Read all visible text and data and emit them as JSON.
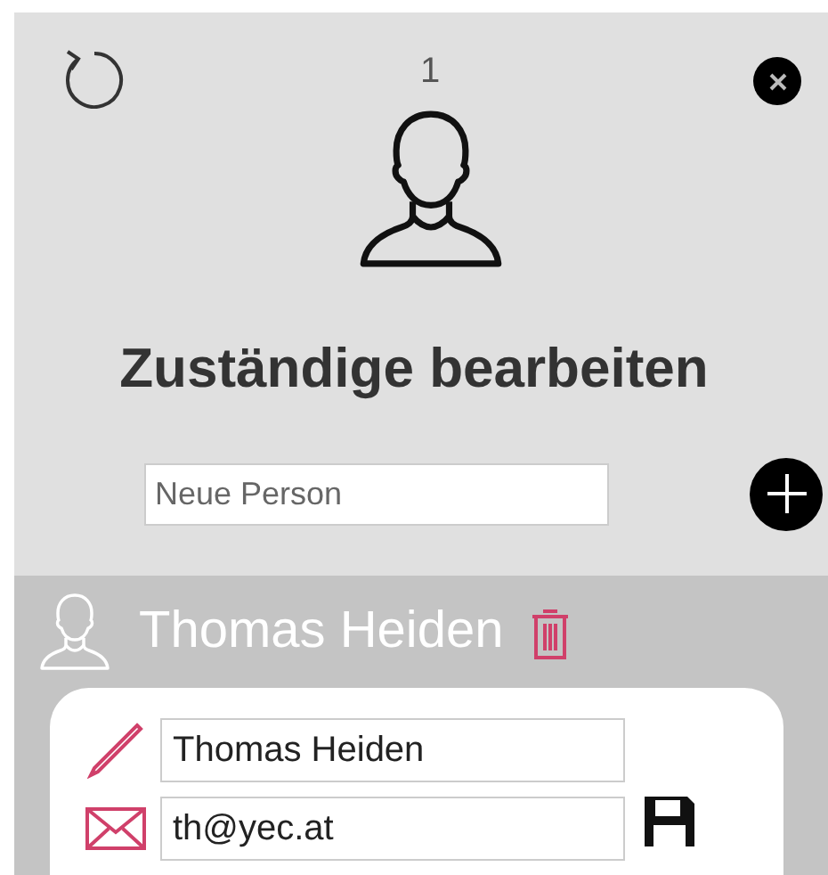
{
  "counter": "1",
  "title": "Zuständige bearbeiten",
  "new_person": {
    "placeholder": "Neue Person"
  },
  "persons": [
    {
      "name": "Thomas Heiden",
      "fields": [
        {
          "kind": "name",
          "value": "Thomas Heiden"
        },
        {
          "kind": "email",
          "value": "th@yec.at"
        }
      ]
    }
  ]
}
